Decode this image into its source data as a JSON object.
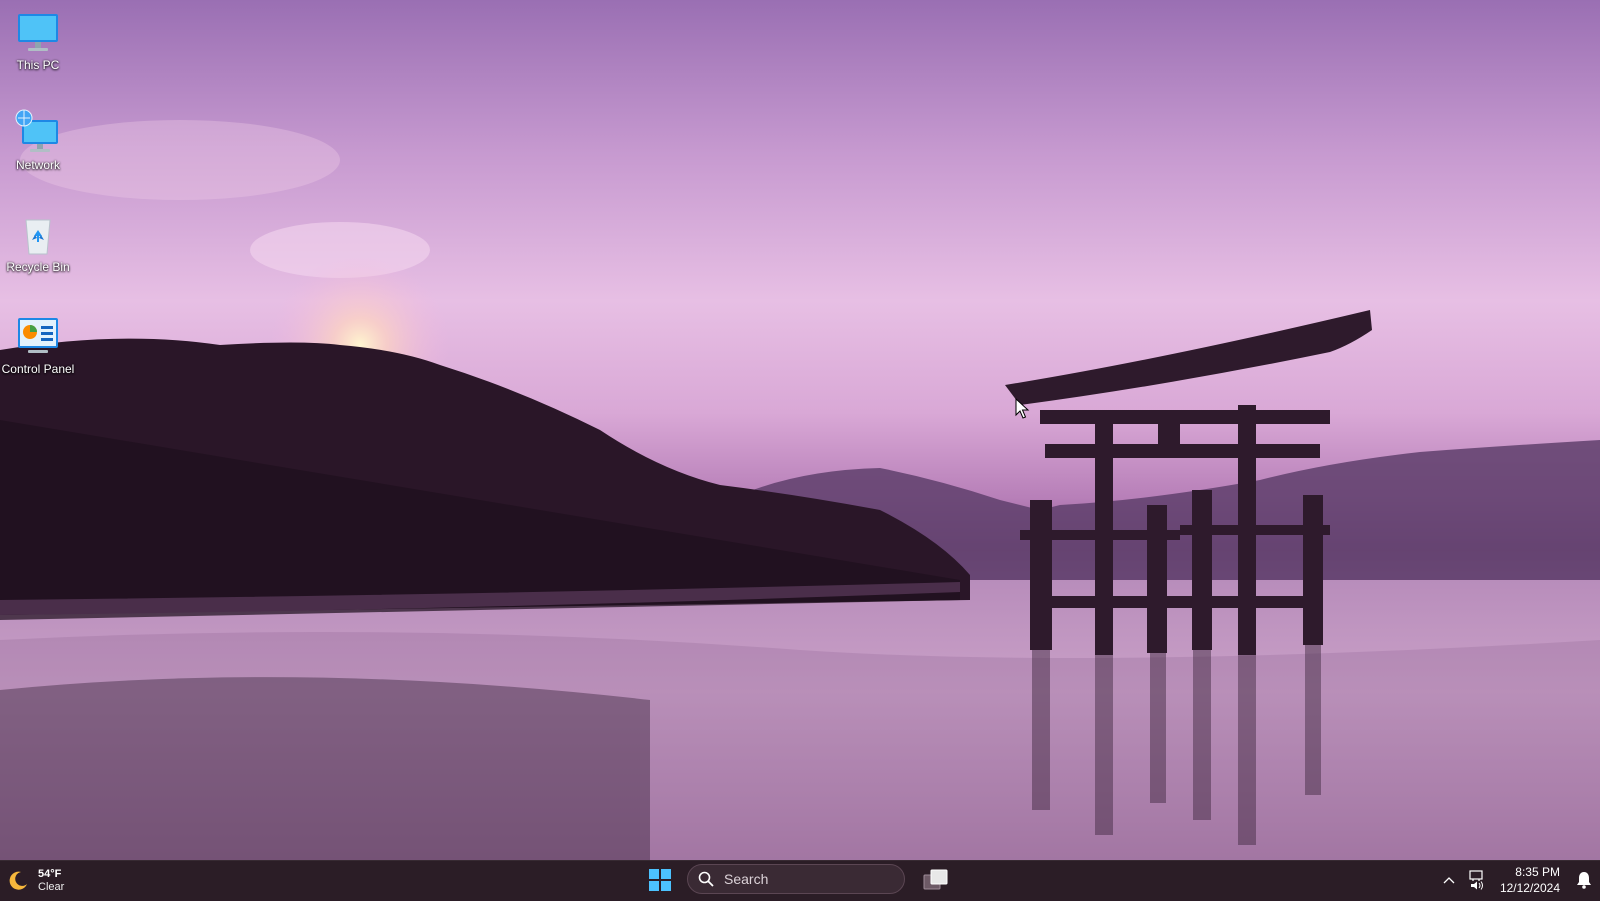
{
  "desktop": {
    "icons": [
      {
        "label": "This PC",
        "icon": "monitor-icon"
      },
      {
        "label": "Network",
        "icon": "network-icon"
      },
      {
        "label": "Recycle Bin",
        "icon": "recycle-bin-icon"
      },
      {
        "label": "Control Panel",
        "icon": "control-panel-icon"
      }
    ]
  },
  "taskbar": {
    "weather": {
      "temperature": "54°F",
      "condition": "Clear",
      "icon": "moon-icon"
    },
    "start_icon": "windows-logo-icon",
    "search": {
      "placeholder": "Search",
      "icon": "search-icon"
    },
    "taskview_icon": "task-view-icon",
    "tray": {
      "chevron_icon": "chevron-up-icon",
      "network_icon": "ethernet-icon",
      "volume_icon": "speaker-icon",
      "notification_icon": "bell-icon"
    },
    "clock": {
      "time": "8:35 PM",
      "date": "12/12/2024"
    }
  },
  "colors": {
    "taskbar_bg": "#2b1d26",
    "sky_top": "#9a6fb3",
    "sky_glow": "#e7bfe4",
    "accent": "#0078d4"
  }
}
